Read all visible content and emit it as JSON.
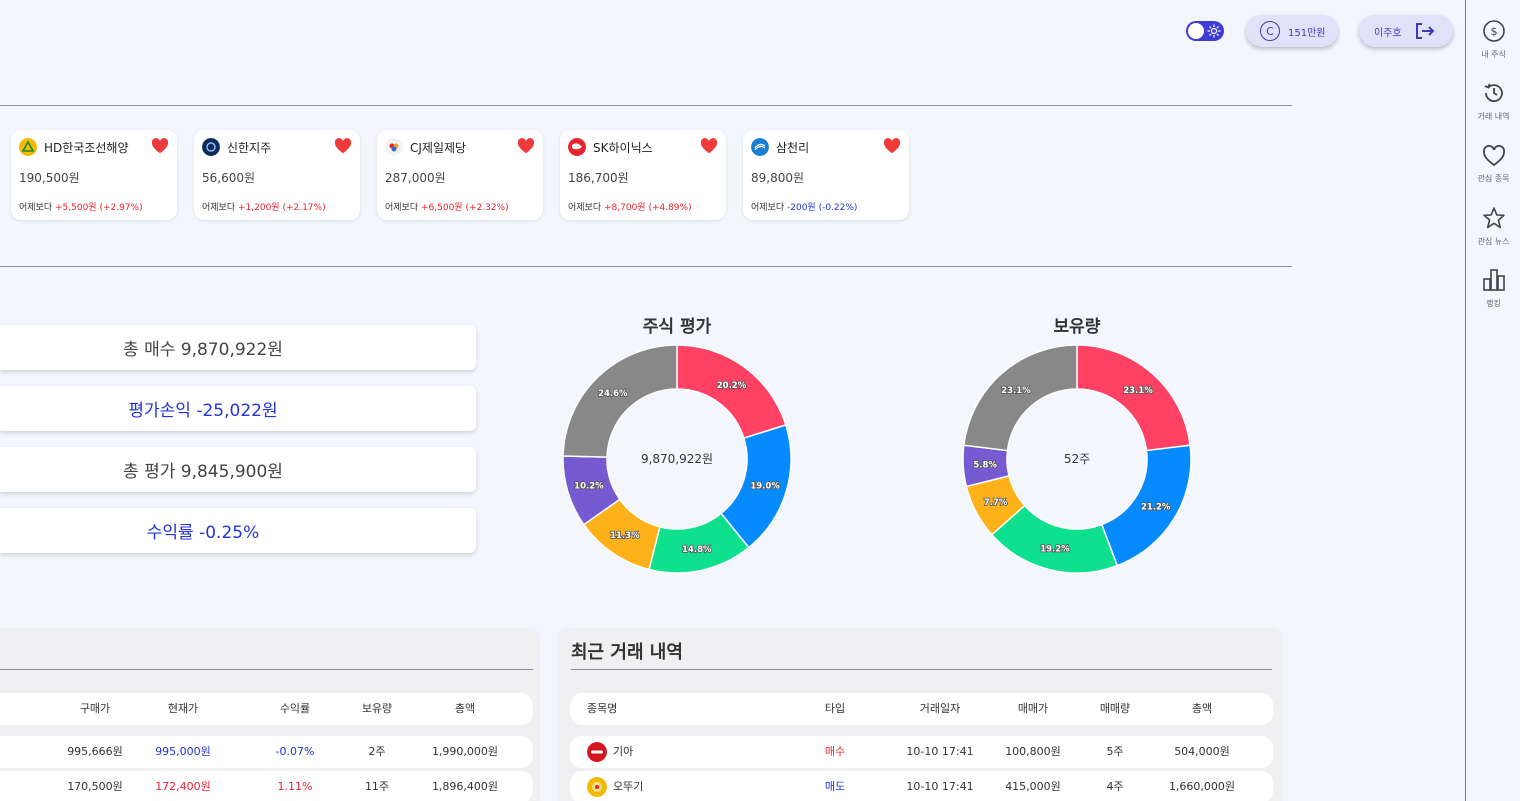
{
  "topbar": {
    "points_label": "151만원",
    "user_name": "이주호"
  },
  "sidebar": {
    "items": [
      {
        "label": "내 주식"
      },
      {
        "label": "거래 내역"
      },
      {
        "label": "관심 종목"
      },
      {
        "label": "관심 뉴스"
      },
      {
        "label": "랭킹"
      }
    ]
  },
  "favorites": [
    {
      "name": "HD한국조선해양",
      "price": "190,500원",
      "change_prefix": "어제보다",
      "change": "+5,500원 (+2.97%)",
      "direction": "up"
    },
    {
      "name": "신한지주",
      "price": "56,600원",
      "change_prefix": "어제보다",
      "change": "+1,200원 (+2.17%)",
      "direction": "up"
    },
    {
      "name": "CJ제일제당",
      "price": "287,000원",
      "change_prefix": "어제보다",
      "change": "+6,500원 (+2.32%)",
      "direction": "up"
    },
    {
      "name": "SK하이닉스",
      "price": "186,700원",
      "change_prefix": "어제보다",
      "change": "+8,700원 (+4.89%)",
      "direction": "up"
    },
    {
      "name": "삼천리",
      "price": "89,800원",
      "change_prefix": "어제보다",
      "change": "-200원 (-0.22%)",
      "direction": "down"
    }
  ],
  "summary": {
    "total_buy": "총 매수 9,870,922원",
    "eval_pnl": "평가손익 -25,022원",
    "total_eval": "총 평가 9,845,900원",
    "return_rate": "수익률 -0.25%"
  },
  "chart_data": [
    {
      "type": "pie",
      "title": "주식 평가",
      "center_label": "9,870,922원",
      "labels": [
        "20.2%",
        "19.0%",
        "14.8%",
        "11.3%",
        "10.2%",
        "24.6%"
      ],
      "values": [
        20.2,
        19.0,
        14.8,
        11.3,
        10.2,
        24.6
      ],
      "colors": [
        "#ff4163",
        "#068bff",
        "#0ee08e",
        "#feb119",
        "#765ad2",
        "#888888"
      ]
    },
    {
      "type": "pie",
      "title": "보유량",
      "center_label": "52주",
      "labels": [
        "23.1%",
        "21.2%",
        "19.2%",
        "7.7%",
        "5.8%",
        "23.1%"
      ],
      "values": [
        23.1,
        21.2,
        19.2,
        7.7,
        5.8,
        23.1
      ],
      "colors": [
        "#ff4163",
        "#068bff",
        "#0ee08e",
        "#feb119",
        "#765ad2",
        "#888888"
      ]
    }
  ],
  "holdings": {
    "headers": [
      "구매가",
      "현재가",
      "수익률",
      "보유량",
      "총액"
    ],
    "rows": [
      {
        "buy": "995,666원",
        "current": "995,000원",
        "rate": "-0.07%",
        "qty": "2주",
        "total": "1,990,000원",
        "dir": "down"
      },
      {
        "buy": "170,500원",
        "current": "172,400원",
        "rate": "1.11%",
        "qty": "11주",
        "total": "1,896,400원",
        "dir": "up"
      }
    ]
  },
  "trades": {
    "title": "최근 거래 내역",
    "headers": [
      "종목명",
      "타입",
      "거래일자",
      "매매가",
      "매매량",
      "총액"
    ],
    "rows": [
      {
        "name": "기아",
        "type": "매수",
        "date": "10-10 17:41",
        "price": "100,800원",
        "qty": "5주",
        "total": "504,000원",
        "type_dir": "buy",
        "logo_color": "#d4141c"
      },
      {
        "name": "오뚜기",
        "type": "매도",
        "date": "10-10 17:41",
        "price": "415,000원",
        "qty": "4주",
        "total": "1,660,000원",
        "type_dir": "sell",
        "logo_color": "#f5b800"
      }
    ]
  }
}
